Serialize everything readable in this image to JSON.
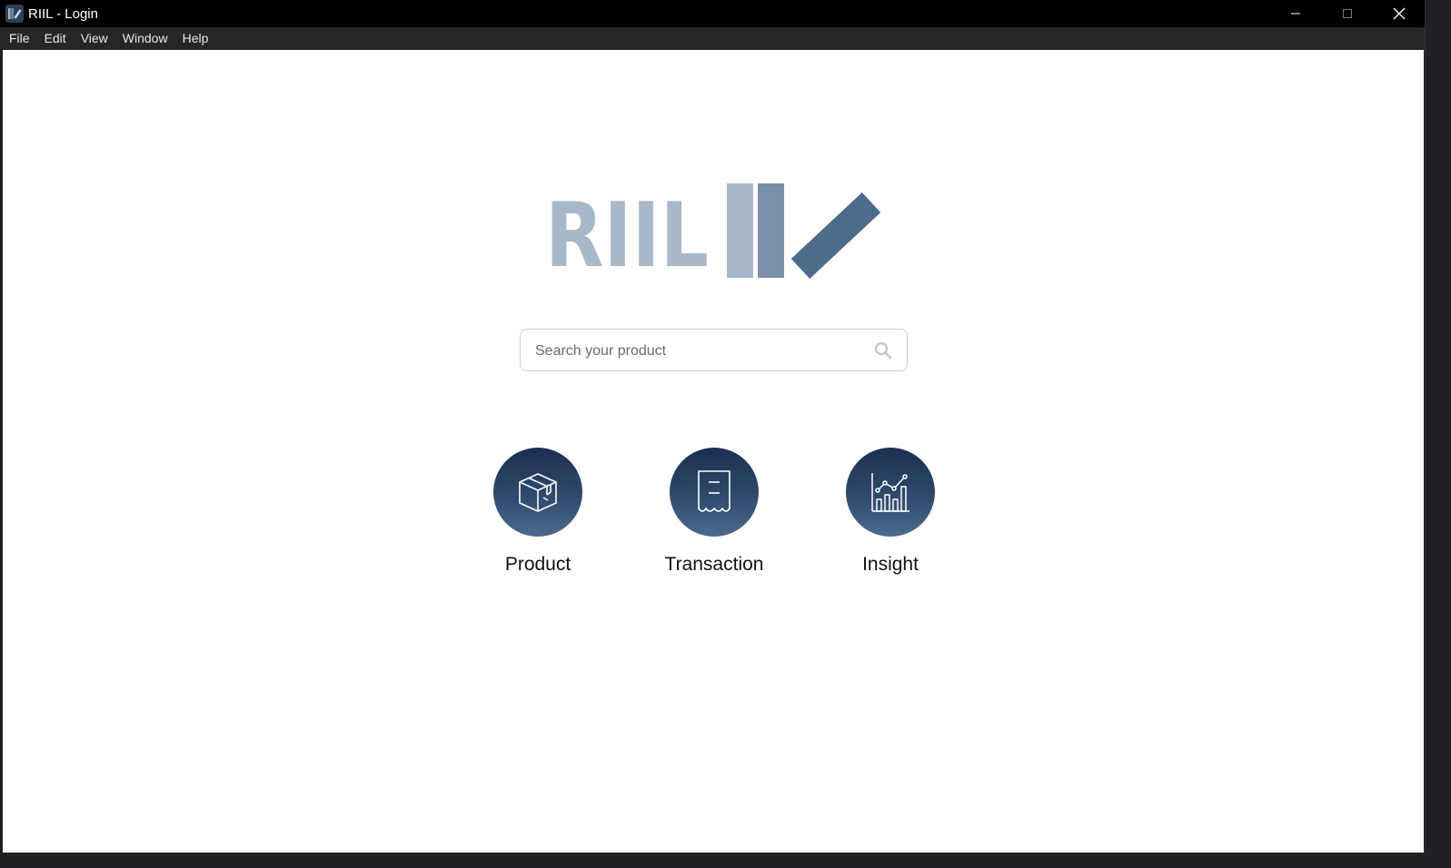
{
  "window": {
    "title": "RIIL - Login"
  },
  "menu": [
    "File",
    "Edit",
    "View",
    "Window",
    "Help"
  ],
  "logo": {
    "text": "RIIL",
    "colors": {
      "letters": "#a7b8c8",
      "bar_light": "#a7b8c8",
      "bar_mid": "#7990a8",
      "slash": "#4d6b8a"
    }
  },
  "search": {
    "placeholder": "Search your product",
    "value": "",
    "icon": "search-icon"
  },
  "tiles": [
    {
      "label": "Product",
      "icon": "package-box-icon"
    },
    {
      "label": "Transaction",
      "icon": "receipt-icon"
    },
    {
      "label": "Insight",
      "icon": "bar-chart-trend-icon"
    }
  ],
  "theme": {
    "tile_gradient_top": "#1b2f4f",
    "tile_gradient_bottom": "#4c6a8d",
    "titlebar_bg": "#000000",
    "menubar_bg": "#262626"
  }
}
